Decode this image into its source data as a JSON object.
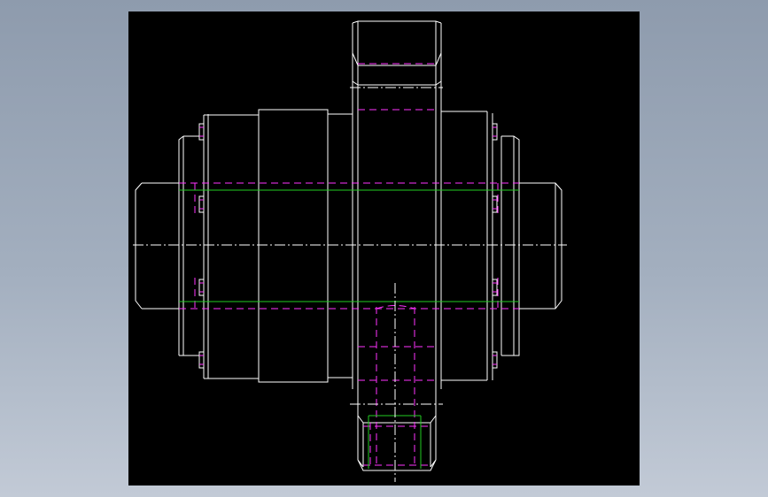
{
  "cad_view": {
    "background_color": "#000000",
    "backdrop_colors": [
      "#8e9bad",
      "#c2cad6"
    ],
    "colors": {
      "outline": "#ffffff",
      "hidden": "#ff33ff",
      "center": "#ffffff",
      "section": "#22cc22"
    },
    "line_types": {
      "outline": "continuous",
      "hidden": "dashed",
      "center": "dash-dot",
      "section": "continuous"
    }
  }
}
